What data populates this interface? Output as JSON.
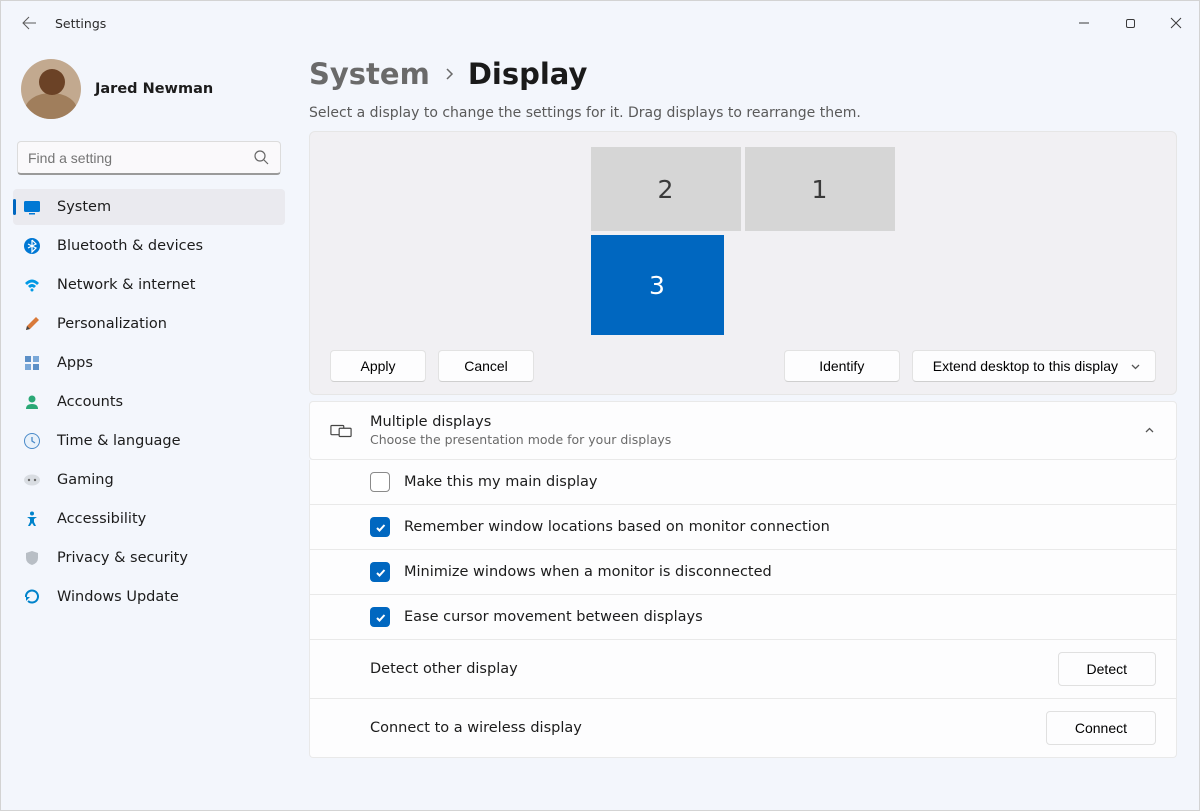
{
  "titlebar": {
    "title": "Settings"
  },
  "user": {
    "name": "Jared Newman"
  },
  "search": {
    "placeholder": "Find a setting"
  },
  "sidebar": {
    "items": [
      {
        "label": "System"
      },
      {
        "label": "Bluetooth & devices"
      },
      {
        "label": "Network & internet"
      },
      {
        "label": "Personalization"
      },
      {
        "label": "Apps"
      },
      {
        "label": "Accounts"
      },
      {
        "label": "Time & language"
      },
      {
        "label": "Gaming"
      },
      {
        "label": "Accessibility"
      },
      {
        "label": "Privacy & security"
      },
      {
        "label": "Windows Update"
      }
    ]
  },
  "breadcrumb": {
    "parent": "System",
    "current": "Display"
  },
  "instruction": "Select a display to change the settings for it. Drag displays to rearrange them.",
  "monitors": {
    "m1": "1",
    "m2": "2",
    "m3": "3"
  },
  "buttons": {
    "apply": "Apply",
    "cancel": "Cancel",
    "identify": "Identify",
    "extend": "Extend desktop to this display"
  },
  "multi": {
    "title": "Multiple displays",
    "subtitle": "Choose the presentation mode for your displays",
    "opt_main": "Make this my main display",
    "opt_remember": "Remember window locations based on monitor connection",
    "opt_minimize": "Minimize windows when a monitor is disconnected",
    "opt_cursor": "Ease cursor movement between displays",
    "detect_label": "Detect other display",
    "detect_btn": "Detect",
    "connect_label": "Connect to a wireless display",
    "connect_btn": "Connect"
  }
}
